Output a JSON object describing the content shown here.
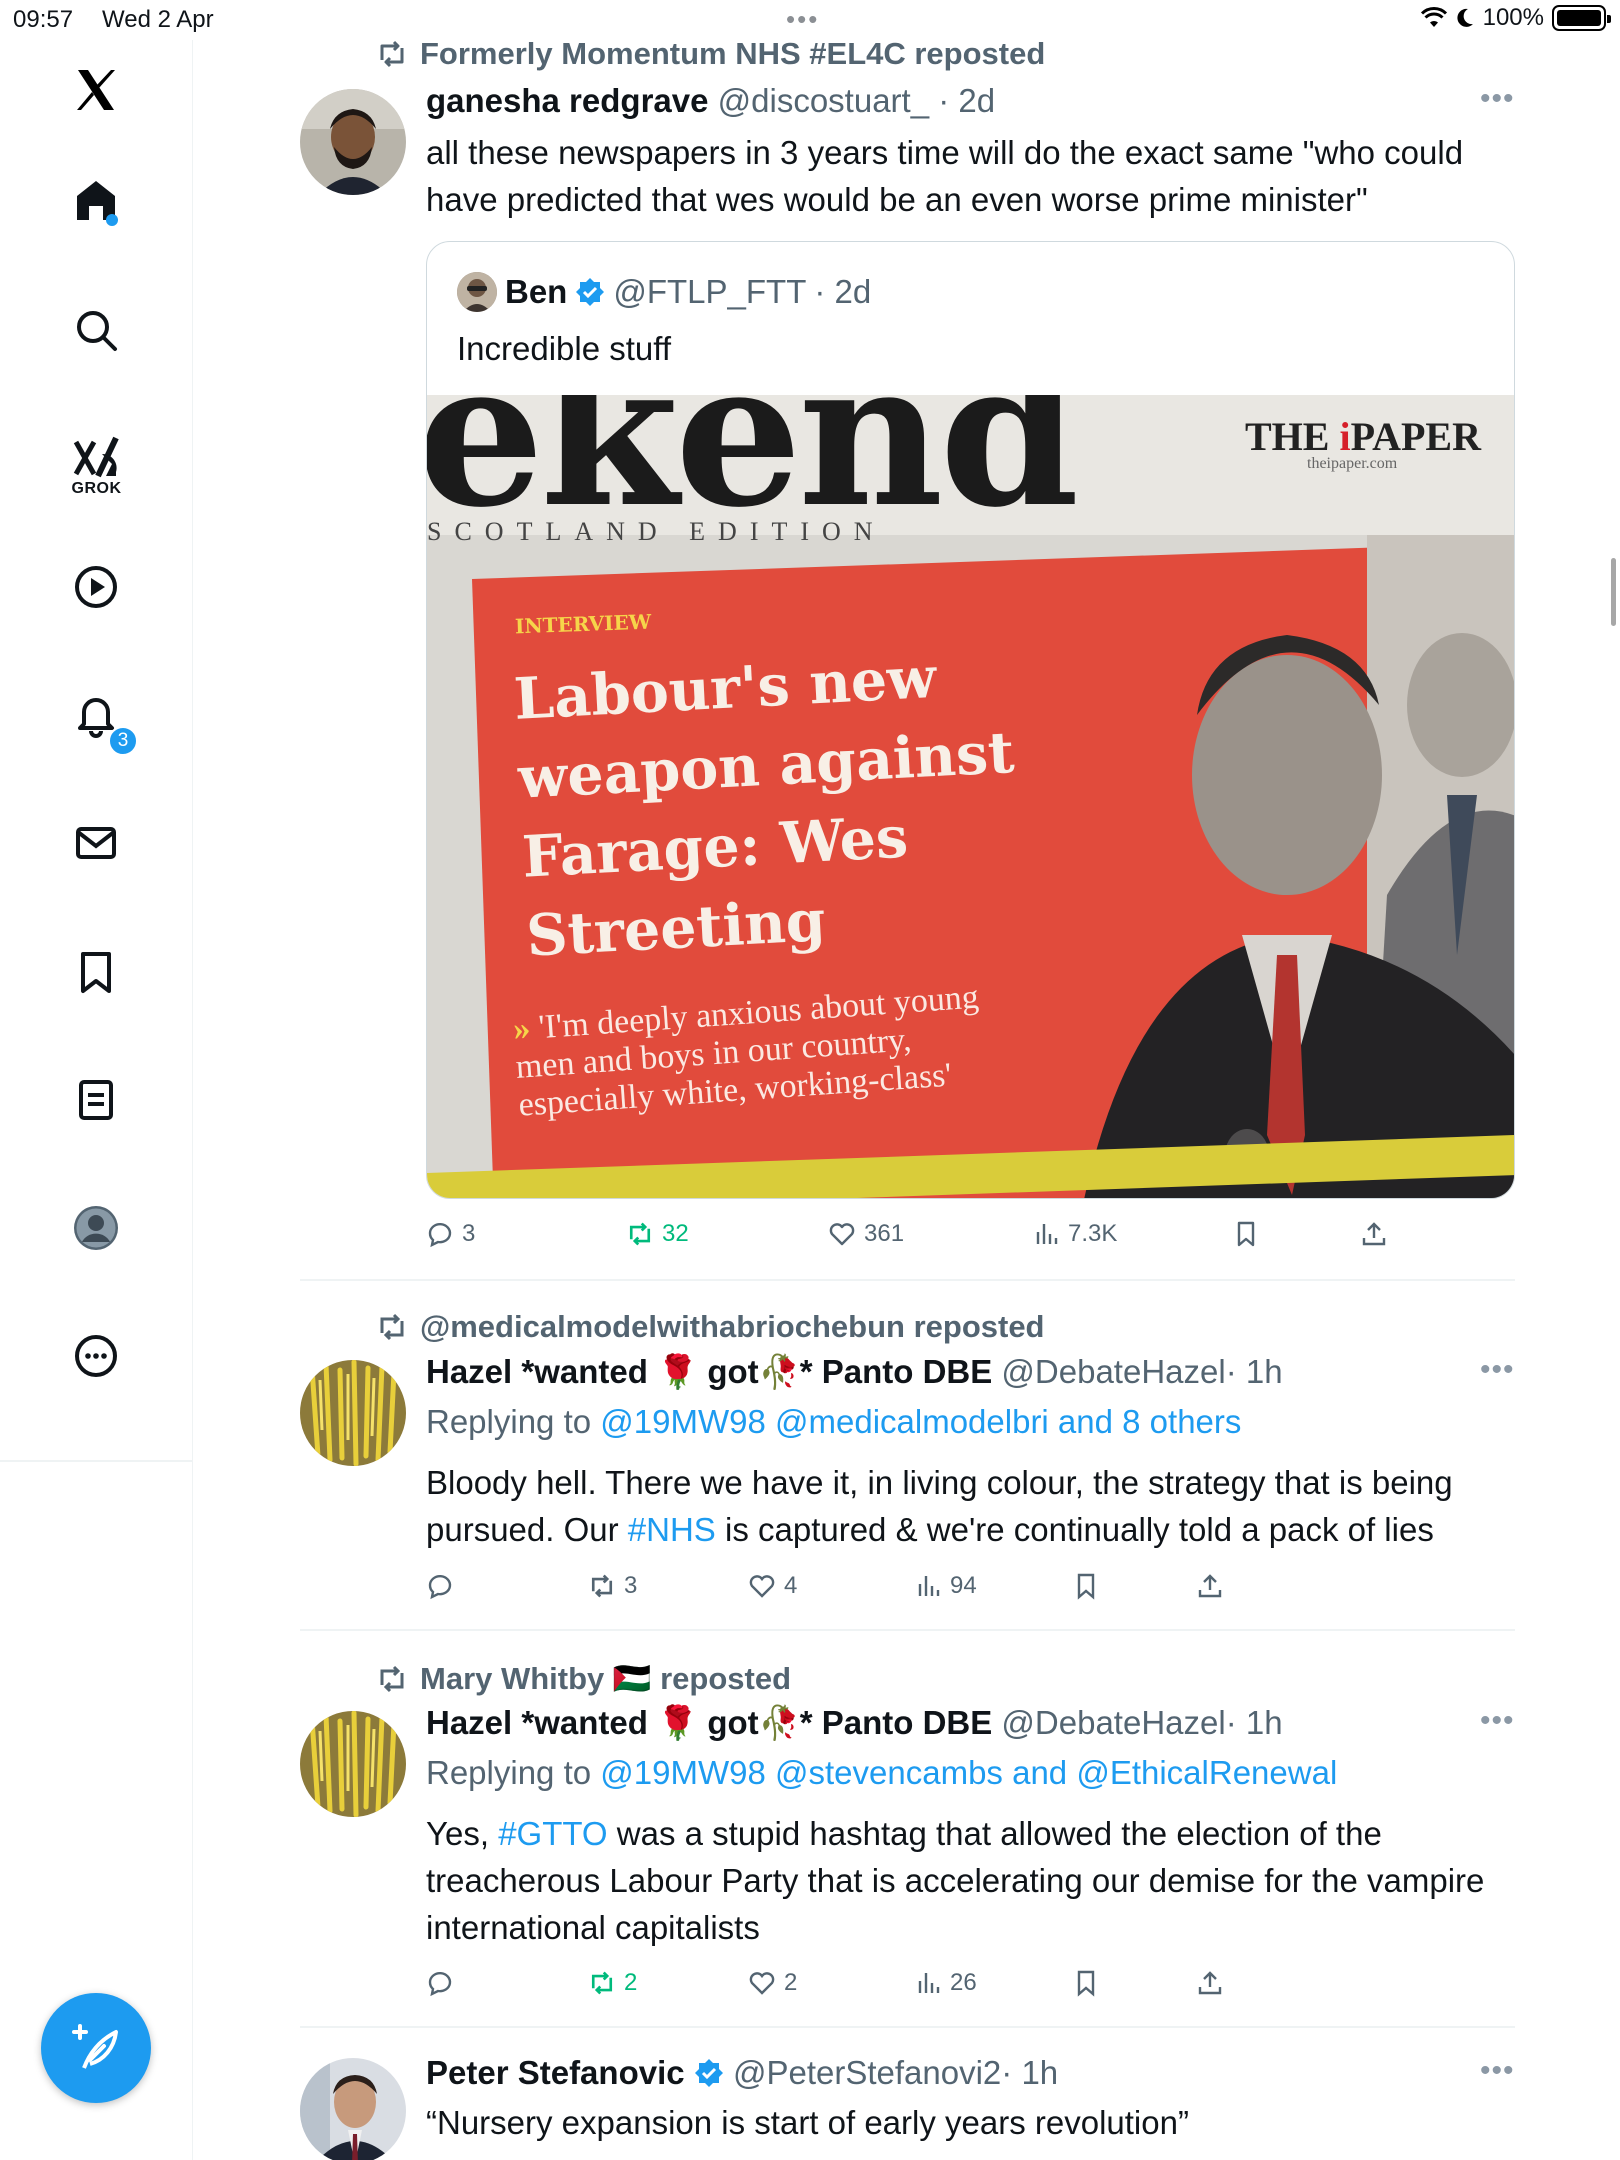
{
  "status_bar": {
    "time": "09:57",
    "date": "Wed 2 Apr",
    "battery": "100%"
  },
  "sidebar": {
    "items": [
      {
        "name": "x-logo-icon"
      },
      {
        "name": "home-icon"
      },
      {
        "name": "search-icon"
      },
      {
        "name": "grok-icon",
        "label": "GROK"
      },
      {
        "name": "video-icon"
      },
      {
        "name": "notifications-icon",
        "badge": "3"
      },
      {
        "name": "messages-icon"
      },
      {
        "name": "bookmarks-icon"
      },
      {
        "name": "lists-icon"
      },
      {
        "name": "profile-icon"
      },
      {
        "name": "more-icon"
      }
    ],
    "compose_icon": "compose-icon",
    "accent": "#1d9bf0"
  },
  "tweets": [
    {
      "reposted_by": "Formerly Momentum NHS #EL4C reposted",
      "name": "ganesha redgrave",
      "handle": "@discostuart_",
      "time": "· 2d",
      "text": "all these newspapers in 3 years time will do the exact same \"who could have predicted that wes would be an even worse prime minister\"",
      "quote": {
        "name": "Ben",
        "handle": "@FTLP_FTT",
        "time": "· 2d",
        "text": "Incredible stuff",
        "image": {
          "masthead": "ekend",
          "brand_a": "THE",
          "brand_i": "i",
          "brand_b": "PAPER",
          "brand_url": "theipaper.com",
          "edition": "SCOTLAND  EDITION",
          "kicker": "INTERVIEW",
          "headline": "Labour's new weapon against Farage: Wes Streeting",
          "pull_arrow": "»",
          "pull_quote": "'I'm deeply anxious about young men and boys in our country, especially white, working-class'"
        }
      },
      "stats": {
        "replies": "3",
        "reposts": "32",
        "likes": "361",
        "views": "7.3K"
      }
    },
    {
      "reposted_by": "@medicalmodelwithabriochebun reposted",
      "name": "Hazel *wanted 🌹 got🥀* Panto DBE",
      "handle": "@DebateHazel",
      "time": "· 1h",
      "reply_prefix": "Replying to",
      "reply_targets": "@19MW98 @medicalmodelbri and 8 others",
      "text_a": "Bloody hell.  There we have it, in living colour, the strategy that is being pursued.  Our",
      "hashtag": "#NHS",
      "text_b": "is captured & we're continually told a pack of lies",
      "stats": {
        "replies": "",
        "reposts": "3",
        "likes": "4",
        "views": "94"
      }
    },
    {
      "reposted_by": "Mary Whitby 🇵🇸 reposted",
      "name": "Hazel *wanted 🌹 got🥀* Panto DBE",
      "handle": "@DebateHazel",
      "time": "· 1h",
      "reply_prefix": "Replying to",
      "reply_targets": "@19MW98 @stevencambs and @EthicalRenewal",
      "text_a": "Yes,",
      "hashtag": "#GTTO",
      "text_b": "was a stupid hashtag that allowed the election of the treacherous Labour Party that is accelerating our demise for the vampire international capitalists",
      "stats": {
        "replies": "",
        "reposts": "2",
        "likes": "2",
        "views": "26"
      }
    },
    {
      "name": "Peter Stefanovic",
      "handle": "@PeterStefanovi2",
      "time": "· 1h",
      "text": "“Nursery expansion is start of early years revolution”"
    }
  ]
}
